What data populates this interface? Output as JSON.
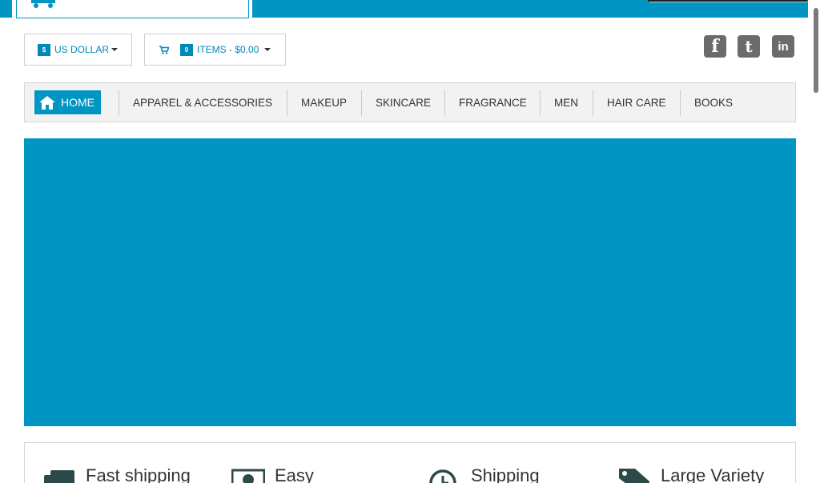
{
  "colors": {
    "brand": "#0095c2",
    "link": "#0088b8",
    "icon_gray": "#6b6b6b"
  },
  "header": {
    "logo_icon": "shopping-cart-icon",
    "search_placeholder": ""
  },
  "currency": {
    "symbol": "$",
    "label": "US DOLLAR"
  },
  "cart": {
    "count": "0",
    "label": "ITEMS - $0.00",
    "icon": "cart-icon"
  },
  "social": [
    {
      "name": "facebook-icon",
      "glyph": "f"
    },
    {
      "name": "twitter-icon",
      "glyph": "t"
    },
    {
      "name": "linkedin-icon",
      "glyph": "in"
    }
  ],
  "nav": {
    "home": "HOME",
    "items": [
      "APPAREL & ACCESSORIES",
      "MAKEUP",
      "SKINCARE",
      "FRAGRANCE",
      "MEN",
      "HAIR CARE",
      "BOOKS"
    ]
  },
  "features": [
    {
      "icon": "truck-icon",
      "text": "Fast shipping"
    },
    {
      "icon": "money-icon",
      "text": "Easy"
    },
    {
      "icon": "clock-icon",
      "text": "Shipping"
    },
    {
      "icon": "tag-icon",
      "text": "Large Variety"
    }
  ]
}
